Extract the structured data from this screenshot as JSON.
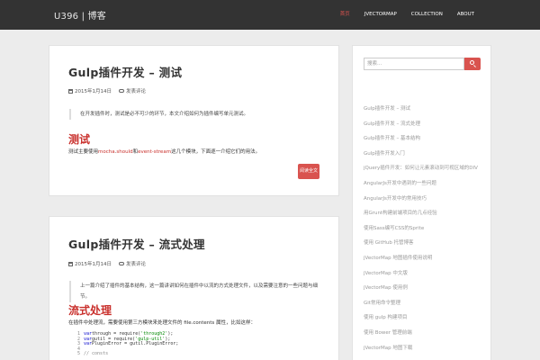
{
  "navbar": {
    "brand": "U396 | 博客",
    "items": [
      "首页",
      "JVECTORMAP",
      "COLLECTION",
      "ABOUT"
    ]
  },
  "posts": [
    {
      "title": "Gulp插件开发 – 测试",
      "date": "2015年1月14日",
      "comments": "发表评论",
      "quote": "在开发插件时，测试是必不可少的环节，本文介绍如何为插件编写单元测试。",
      "section_heading": "测试",
      "para_pre": "测试主要使用",
      "link1": "mocha",
      "sep1": ".",
      "link2": "should",
      "sep2": "和",
      "link3": "event-stream",
      "para_post": "这几个模块，下面逐一介绍它们的用法。",
      "readmore": "阅读全文"
    },
    {
      "title": "Gulp插件开发 – 流式处理",
      "date": "2015年1月14日",
      "comments": "发表评论",
      "quote": "上一篇介绍了插件的基本结构，这一篇讲讲如何在插件中以流的方式处理文件，以及需要注意的一些问题与细节。",
      "section_heading": "流式处理",
      "para": "在插件中处理流，需要使用第三方模块来处理文件的 file.contents 属性，比如这样：",
      "code_lines": [
        {
          "n": "1",
          "kw": "var",
          "rest": " through = require(",
          "str": "'through2'",
          "end": ");"
        },
        {
          "n": "2",
          "kw": "var",
          "rest": " gutil = require(",
          "str": "'gulp-util'",
          "end": ");"
        },
        {
          "n": "3",
          "kw": "var",
          "rest": " PluginError = gutil.PluginError;",
          "str": "",
          "end": ""
        },
        {
          "n": "4",
          "kw": "",
          "rest": "",
          "str": "",
          "end": ""
        },
        {
          "n": "5",
          "kw": "",
          "rest": "",
          "str": "",
          "end": "",
          "cmt": "// consts"
        }
      ]
    }
  ],
  "sidebar": {
    "search_placeholder": "搜索...",
    "recent_posts": [
      "Gulp插件开发 – 测试",
      "Gulp插件开发 – 流式处理",
      "Gulp插件开发 – 基本结构",
      "Gulp插件开发入门",
      "jQuery插件开发：如何让元素滚动到可视区域的DIV",
      "AngularJs开发中遇到的一些问题",
      "AngularJs开发中的常用技巧",
      "用Grunt构建前端项目的几点经验",
      "使用Sass编写CSS的Sprite",
      "使用 GitHub 托管博客",
      "jVectorMap 地图插件使用说明",
      "jVectorMap 中文版",
      "jVectorMap 使用例",
      "Git常用命令整理",
      "使用 gulp 构建项目",
      "使用 Bower 管理前端",
      "jVectorMap 地图下载"
    ]
  }
}
